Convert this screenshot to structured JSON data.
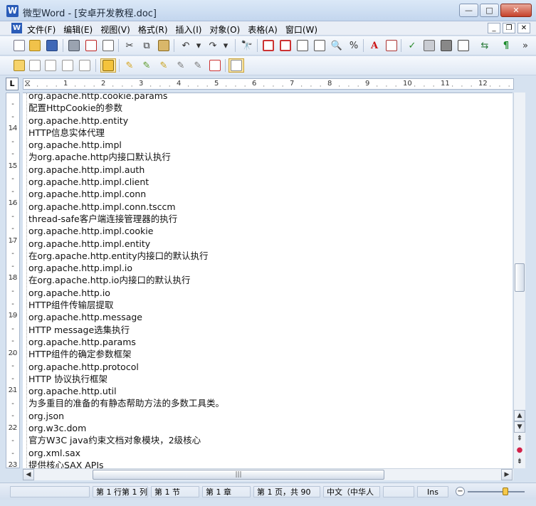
{
  "window": {
    "title": "微型Word - [安卓开发教程.doc]",
    "controls": {
      "minimize": "—",
      "maximize": "□",
      "close": "✕"
    }
  },
  "menu": {
    "items": [
      "文件(F)",
      "编辑(E)",
      "视图(V)",
      "格式(R)",
      "插入(I)",
      "对象(O)",
      "表格(A)",
      "窗口(W)"
    ]
  },
  "ruler": {
    "corner": "L",
    "numbers": [
      "1",
      "2",
      "3",
      "4",
      "5",
      "6",
      "7",
      "8",
      "9",
      "10",
      "11",
      "12"
    ]
  },
  "vruler": {
    "numbers": [
      "14",
      "15",
      "16",
      "17",
      "18",
      "19",
      "20",
      "21",
      "22",
      "23"
    ]
  },
  "document": {
    "lines": [
      "org.apache.http.cookie.params",
      "配置HttpCookie的参数",
      "org.apache.http.entity",
      "HTTP信息实体代理",
      "org.apache.http.impl",
      "为org.apache.http内接口默认执行",
      "org.apache.http.impl.auth",
      "org.apache.http.impl.client",
      "org.apache.http.impl.conn",
      "org.apache.http.impl.conn.tsccm",
      "thread-safe客户端连接管理器的执行",
      "org.apache.http.impl.cookie",
      "org.apache.http.impl.entity",
      "在org.apache.http.entity内接口的默认执行",
      "org.apache.http.impl.io",
      "在org.apache.http.io内接口的默认执行",
      "org.apache.http.io",
      "HTTP组件传输层提取",
      "org.apache.http.message",
      "HTTP  message选集执行",
      "org.apache.http.params",
      "HTTP组件的确定参数框架",
      "org.apache.http.protocol",
      "HTTP 协议执行框架",
      "org.apache.http.util",
      "为多重目的准备的有静态帮助方法的多数工具类。",
      "org.json",
      "org.w3c.dom",
      "官方W3C java约束文档对象模块，2级核心",
      "org.xml.sax",
      "提供核心SAX APIs"
    ]
  },
  "statusbar": {
    "position": "第 1 行第 1 列",
    "section": "第 1 节",
    "chapter": "第 1 章",
    "page": "第 1 页，共 90",
    "language": "中文（中华人",
    "mode": "Ins"
  },
  "zoom": {
    "level": 0.66
  }
}
